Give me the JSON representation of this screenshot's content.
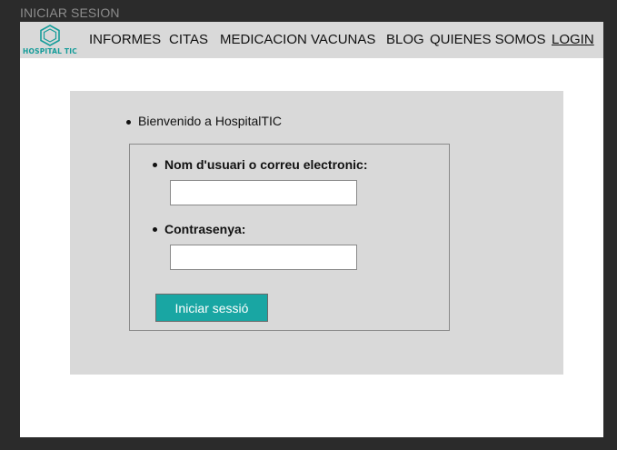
{
  "window": {
    "title": "INICIAR SESION"
  },
  "brand": {
    "logo_text": "HOSPITAL TIC",
    "accent": "#19a6a3"
  },
  "nav": {
    "items": [
      "INFORMES",
      "CITAS",
      "MEDICACION",
      "VACUNAS",
      "BLOG",
      "QUIENES SOMOS",
      "LOGIN"
    ],
    "active": "LOGIN"
  },
  "main": {
    "welcome": "Bienvenido a HospitalTIC",
    "form": {
      "username_label": "Nom d'usuari o correu electronic:",
      "username_value": "",
      "password_label": "Contrasenya:",
      "password_value": "",
      "submit_label": "Iniciar sessió"
    }
  }
}
